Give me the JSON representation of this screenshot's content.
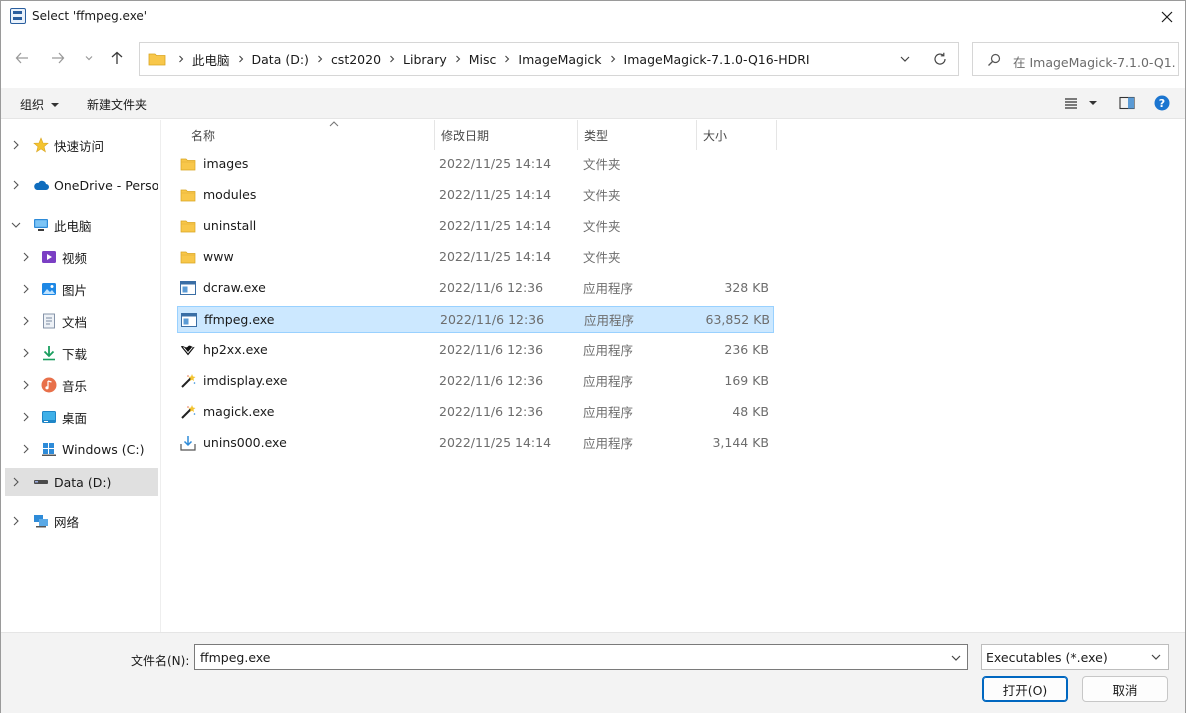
{
  "window": {
    "title": "Select 'ffmpeg.exe'"
  },
  "address": {
    "crumbs": [
      "此电脑",
      "Data (D:)",
      "cst2020",
      "Library",
      "Misc",
      "ImageMagick",
      "ImageMagick-7.1.0-Q16-HDRI"
    ]
  },
  "search": {
    "placeholder": "在 ImageMagick-7.1.0-Q1..."
  },
  "commandbar": {
    "organize": "组织",
    "new_folder": "新建文件夹"
  },
  "navpane": {
    "quick_access": "快速访问",
    "onedrive": "OneDrive - Persor",
    "this_pc": "此电脑",
    "videos": "视频",
    "pictures": "图片",
    "documents": "文档",
    "downloads": "下载",
    "music": "音乐",
    "desktop": "桌面",
    "windows_c": "Windows (C:)",
    "data_d": "Data (D:)",
    "network": "网络"
  },
  "columns": {
    "name": "名称",
    "modified": "修改日期",
    "type": "类型",
    "size": "大小"
  },
  "files": [
    {
      "name": "images",
      "modified": "2022/11/25 14:14",
      "type": "文件夹",
      "size": "",
      "icon": "folder-icon"
    },
    {
      "name": "modules",
      "modified": "2022/11/25 14:14",
      "type": "文件夹",
      "size": "",
      "icon": "folder-icon"
    },
    {
      "name": "uninstall",
      "modified": "2022/11/25 14:14",
      "type": "文件夹",
      "size": "",
      "icon": "folder-icon"
    },
    {
      "name": "www",
      "modified": "2022/11/25 14:14",
      "type": "文件夹",
      "size": "",
      "icon": "folder-icon"
    },
    {
      "name": "dcraw.exe",
      "modified": "2022/11/6 12:36",
      "type": "应用程序",
      "size": "328 KB",
      "icon": "exe-window-icon"
    },
    {
      "name": "ffmpeg.exe",
      "modified": "2022/11/6 12:36",
      "type": "应用程序",
      "size": "63,852 KB",
      "icon": "exe-window-icon"
    },
    {
      "name": "hp2xx.exe",
      "modified": "2022/11/6 12:36",
      "type": "应用程序",
      "size": "236 KB",
      "icon": "hp2xx-icon"
    },
    {
      "name": "imdisplay.exe",
      "modified": "2022/11/6 12:36",
      "type": "应用程序",
      "size": "169 KB",
      "icon": "magic-wand-icon"
    },
    {
      "name": "magick.exe",
      "modified": "2022/11/6 12:36",
      "type": "应用程序",
      "size": "48 KB",
      "icon": "magic-wand-icon"
    },
    {
      "name": "unins000.exe",
      "modified": "2022/11/25 14:14",
      "type": "应用程序",
      "size": "3,144 KB",
      "icon": "installer-icon"
    }
  ],
  "selected_file": "ffmpeg.exe",
  "bottom": {
    "filename_label": "文件名(N):",
    "filename_value": "ffmpeg.exe",
    "filetype": "Executables (*.exe)",
    "open_label": "打开(O)",
    "cancel_label": "取消"
  },
  "colors": {
    "accent": "#0067c0",
    "selection": "#cce8ff",
    "selection_border": "#99d1ff",
    "folder": "#f8c74a"
  }
}
